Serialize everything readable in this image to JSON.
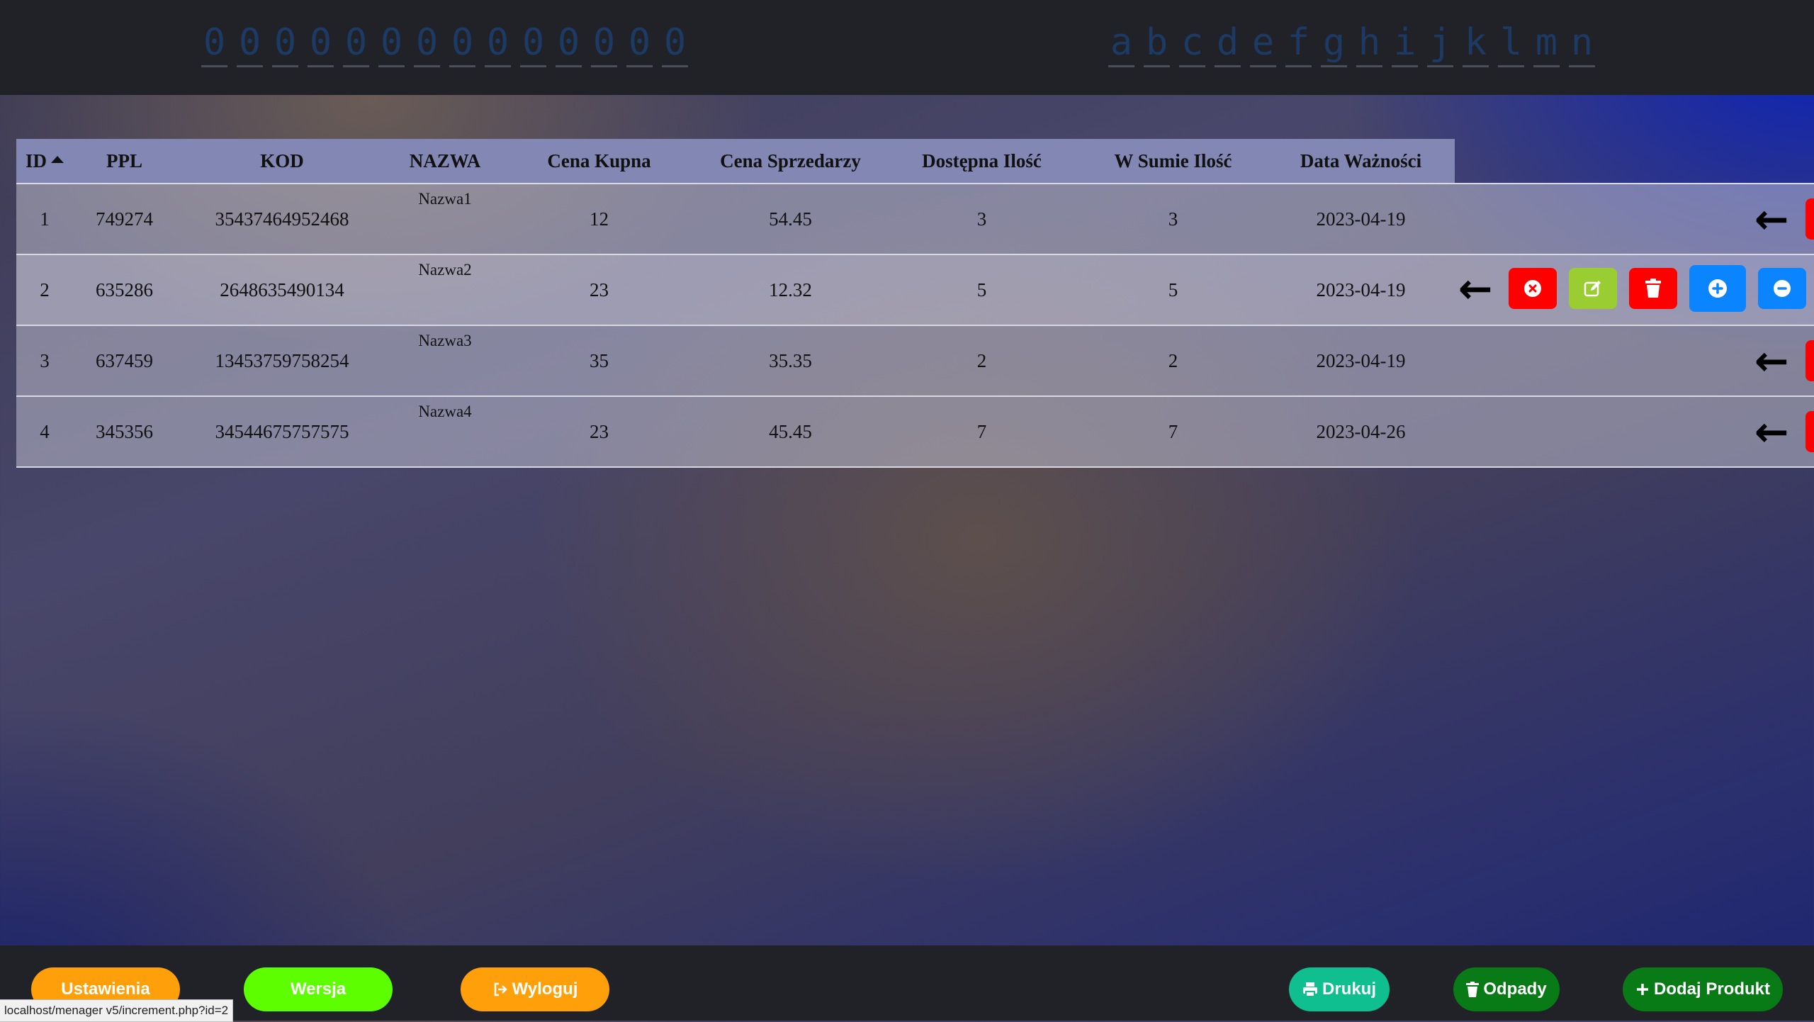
{
  "top_codes": {
    "left": [
      "0",
      "0",
      "0",
      "0",
      "0",
      "0",
      "0",
      "0",
      "0",
      "0",
      "0",
      "0",
      "0",
      "0"
    ],
    "right": [
      "a",
      "b",
      "c",
      "d",
      "e",
      "f",
      "g",
      "h",
      "i",
      "j",
      "k",
      "l",
      "m",
      "n"
    ]
  },
  "table": {
    "headers": [
      "ID",
      "PPL",
      "KOD",
      "NAZWA",
      "Cena Kupna",
      "Cena Sprzedarzy",
      "Dostępna Ilość",
      "W Sumie Ilość",
      "Data Ważności"
    ],
    "sort": {
      "column": "ID",
      "direction": "ascending"
    },
    "rows": [
      {
        "id": "1",
        "ppl": "749274",
        "kod": "35437464952468",
        "nazwa": "Nazwa1",
        "cena_kupna": "12",
        "cena_sprzedarzy": "54.45",
        "dostepna": "3",
        "w_sumie": "3",
        "data": "2023-04-19"
      },
      {
        "id": "2",
        "ppl": "635286",
        "kod": "2648635490134",
        "nazwa": "Nazwa2",
        "cena_kupna": "23",
        "cena_sprzedarzy": "12.32",
        "dostepna": "5",
        "w_sumie": "5",
        "data": "2023-04-19"
      },
      {
        "id": "3",
        "ppl": "637459",
        "kod": "13453759758254",
        "nazwa": "Nazwa3",
        "cena_kupna": "35",
        "cena_sprzedarzy": "35.35",
        "dostepna": "2",
        "w_sumie": "2",
        "data": "2023-04-19"
      },
      {
        "id": "4",
        "ppl": "345356",
        "kod": "34544675757575",
        "nazwa": "Nazwa4",
        "cena_kupna": "23",
        "cena_sprzedarzy": "45.45",
        "dostepna": "7",
        "w_sumie": "7",
        "data": "2023-04-26"
      }
    ],
    "row_actions": [
      "arrow-left-icon",
      "cancel-icon",
      "edit-icon",
      "trash-icon",
      "plus-icon",
      "minus-icon"
    ]
  },
  "bottom": {
    "settings": "Ustawienia",
    "version": "Wersja",
    "logout": "Wyloguj",
    "print": "Drukuj",
    "waste": "Odpady",
    "add_product": "Dodaj Produkt"
  },
  "status_url": "localhost/menager v5/increment.php?id=2",
  "colors": {
    "bar_bg": "#212228",
    "orange": "#ff9f0a",
    "lime": "#5dff00",
    "teal": "#0fbf8f",
    "dark_green": "#087a16",
    "red": "#ff0000",
    "yellow_green": "#9acd32",
    "blue": "#0a84ff",
    "header_bg": "#8387b3"
  }
}
